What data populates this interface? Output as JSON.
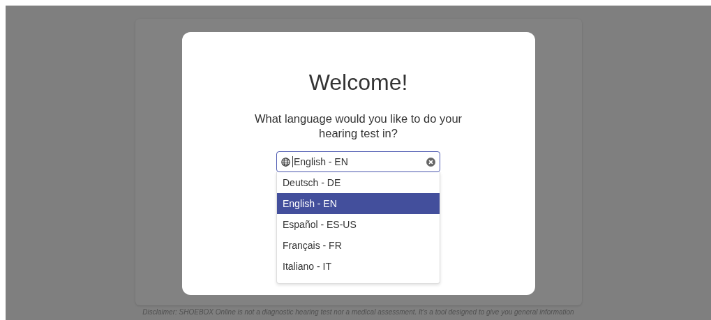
{
  "dialog": {
    "title": "Welcome!",
    "question": "What language would you like to do your hearing test in?",
    "language_select": {
      "value": "English - EN",
      "options": [
        {
          "label": "Deutsch - DE",
          "selected": false
        },
        {
          "label": "English - EN",
          "selected": true
        },
        {
          "label": "Español - ES-US",
          "selected": false
        },
        {
          "label": "Français - FR",
          "selected": false
        },
        {
          "label": "Italiano - IT",
          "selected": false
        }
      ]
    }
  },
  "disclaimer": "Disclaimer: SHOEBOX Online is not a diagnostic hearing test nor a medical assessment. It's a tool designed to give you general information"
}
